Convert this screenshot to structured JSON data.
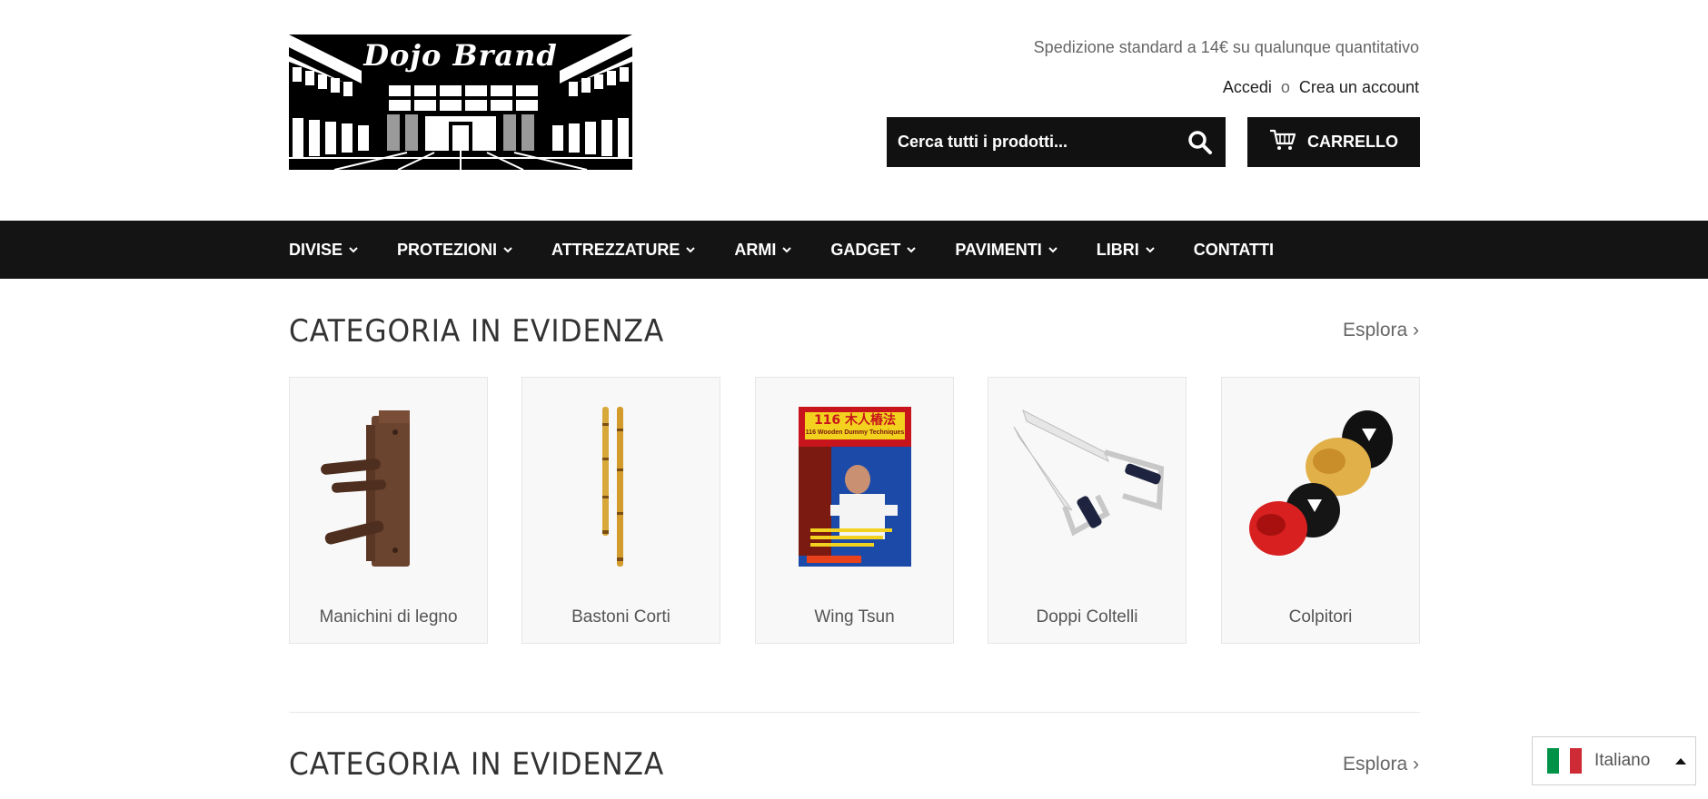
{
  "header": {
    "logo_text": "Dojo Brand",
    "shipping_text": "Spedizione standard a 14€ su qualunque quantitativo",
    "login_label": "Accedi",
    "separator": "o",
    "register_label": "Crea un account",
    "search_placeholder": "Cerca tutti i prodotti...",
    "cart_label": "CARRELLO"
  },
  "nav": {
    "items": [
      {
        "label": "DIVISE"
      },
      {
        "label": "PROTEZIONI"
      },
      {
        "label": "ATTREZZATURE"
      },
      {
        "label": "ARMI"
      },
      {
        "label": "GADGET"
      },
      {
        "label": "PAVIMENTI"
      },
      {
        "label": "LIBRI"
      },
      {
        "label": "CONTATTI"
      }
    ]
  },
  "sections": [
    {
      "title": "CATEGORIA IN EVIDENZA",
      "explore_label": "Esplora ›",
      "cards": [
        {
          "label": "Manichini di legno",
          "icon": "wooden-dummy-image"
        },
        {
          "label": "Bastoni Corti",
          "icon": "short-sticks-image"
        },
        {
          "label": "Wing Tsun",
          "icon": "book-cover-image"
        },
        {
          "label": "Doppi Coltelli",
          "icon": "butterfly-knives-image"
        },
        {
          "label": "Colpitori",
          "icon": "focus-mitts-image"
        }
      ]
    },
    {
      "title": "CATEGORIA IN EVIDENZA",
      "explore_label": "Esplora ›"
    }
  ],
  "language": {
    "label": "Italiano",
    "flag_colors": [
      "#009246",
      "#ffffff",
      "#ce2b37"
    ]
  },
  "book_cover": {
    "title_text": "116 木人樁法",
    "subtitle_text": "116 Wooden Dummy Techniques"
  }
}
